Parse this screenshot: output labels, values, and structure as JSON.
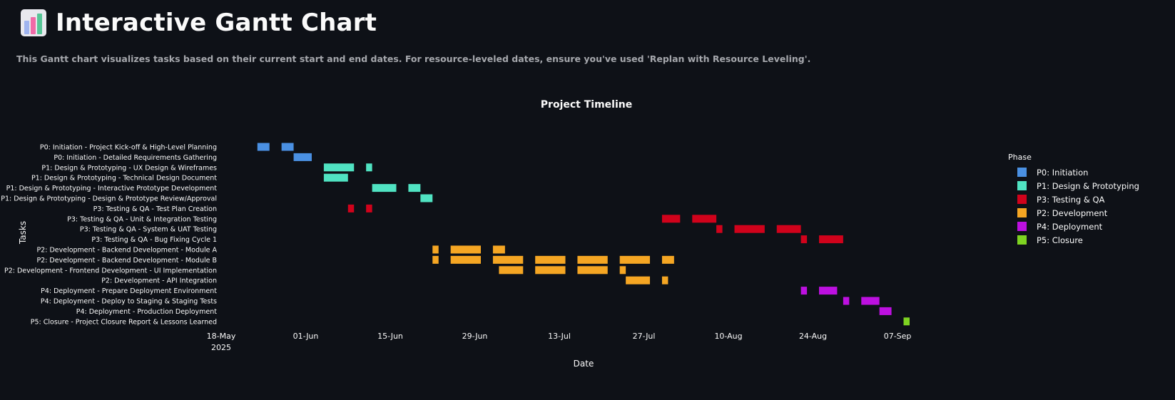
{
  "header": {
    "icon": "bar-chart-icon",
    "title": "Interactive Gantt Chart",
    "subtitle": "This Gantt chart visualizes tasks based on their current start and end dates. For resource-leveled dates, ensure you've used 'Replan with Resource Leveling'."
  },
  "legend": {
    "title": "Phase",
    "items": [
      {
        "label": "P0: Initiation",
        "color": "#4a90e2"
      },
      {
        "label": "P1: Design & Prototyping",
        "color": "#50e3c2"
      },
      {
        "label": "P3: Testing & QA",
        "color": "#d0021b"
      },
      {
        "label": "P2: Development",
        "color": "#f5a623"
      },
      {
        "label": "P4: Deployment",
        "color": "#bd10e0"
      },
      {
        "label": "P5: Closure",
        "color": "#7ed321"
      }
    ]
  },
  "chart_data": {
    "type": "bar",
    "subtype": "gantt",
    "title": "Project Timeline",
    "xlabel": "Date",
    "ylabel": "Tasks",
    "x_range": [
      "2025-05-18",
      "2025-09-09"
    ],
    "x_ticks": [
      {
        "date": "2025-05-18",
        "label": "18-May",
        "sublabel": "2025"
      },
      {
        "date": "2025-06-01",
        "label": "01-Jun"
      },
      {
        "date": "2025-06-15",
        "label": "15-Jun"
      },
      {
        "date": "2025-06-29",
        "label": "29-Jun"
      },
      {
        "date": "2025-07-13",
        "label": "13-Jul"
      },
      {
        "date": "2025-07-27",
        "label": "27-Jul"
      },
      {
        "date": "2025-08-10",
        "label": "10-Aug"
      },
      {
        "date": "2025-08-24",
        "label": "24-Aug"
      },
      {
        "date": "2025-09-07",
        "label": "07-Sep"
      }
    ],
    "legend_position": "right",
    "grid": false,
    "tasks": [
      {
        "name": "P0: Initiation - Project Kick-off & High-Level Planning",
        "phase": "P0: Initiation",
        "segments": [
          [
            "2025-05-24",
            "2025-05-26"
          ],
          [
            "2025-05-28",
            "2025-05-30"
          ]
        ]
      },
      {
        "name": "P0: Initiation - Detailed Requirements Gathering",
        "phase": "P0: Initiation",
        "segments": [
          [
            "2025-05-30",
            "2025-06-02"
          ]
        ]
      },
      {
        "name": "P1: Design & Prototyping - UX Design & Wireframes",
        "phase": "P1: Design & Prototyping",
        "segments": [
          [
            "2025-06-04",
            "2025-06-09"
          ],
          [
            "2025-06-11",
            "2025-06-12"
          ]
        ]
      },
      {
        "name": "P1: Design & Prototyping - Technical Design Document",
        "phase": "P1: Design & Prototyping",
        "segments": [
          [
            "2025-06-04",
            "2025-06-08"
          ]
        ]
      },
      {
        "name": "P1: Design & Prototyping - Interactive Prototype Development",
        "phase": "P1: Design & Prototyping",
        "segments": [
          [
            "2025-06-12",
            "2025-06-16"
          ],
          [
            "2025-06-18",
            "2025-06-20"
          ]
        ]
      },
      {
        "name": "P1: Design & Prototyping - Design & Prototype Review/Approval",
        "phase": "P1: Design & Prototyping",
        "segments": [
          [
            "2025-06-20",
            "2025-06-22"
          ]
        ]
      },
      {
        "name": "P3: Testing & QA - Test Plan Creation",
        "phase": "P3: Testing & QA",
        "segments": [
          [
            "2025-06-08",
            "2025-06-09"
          ],
          [
            "2025-06-11",
            "2025-06-12"
          ]
        ]
      },
      {
        "name": "P3: Testing & QA - Unit & Integration Testing",
        "phase": "P3: Testing & QA",
        "segments": [
          [
            "2025-07-30",
            "2025-08-02"
          ],
          [
            "2025-08-04",
            "2025-08-08"
          ]
        ]
      },
      {
        "name": "P3: Testing & QA - System & UAT Testing",
        "phase": "P3: Testing & QA",
        "segments": [
          [
            "2025-08-08",
            "2025-08-09"
          ],
          [
            "2025-08-11",
            "2025-08-16"
          ],
          [
            "2025-08-18",
            "2025-08-22"
          ]
        ]
      },
      {
        "name": "P3: Testing & QA - Bug Fixing Cycle 1",
        "phase": "P3: Testing & QA",
        "segments": [
          [
            "2025-08-22",
            "2025-08-23"
          ],
          [
            "2025-08-25",
            "2025-08-29"
          ]
        ]
      },
      {
        "name": "P2: Development - Backend Development - Module A",
        "phase": "P2: Development",
        "segments": [
          [
            "2025-06-22",
            "2025-06-23"
          ],
          [
            "2025-06-25",
            "2025-06-30"
          ],
          [
            "2025-07-02",
            "2025-07-04"
          ]
        ]
      },
      {
        "name": "P2: Development - Backend Development - Module B",
        "phase": "P2: Development",
        "segments": [
          [
            "2025-06-22",
            "2025-06-23"
          ],
          [
            "2025-06-25",
            "2025-06-30"
          ],
          [
            "2025-07-02",
            "2025-07-07"
          ],
          [
            "2025-07-09",
            "2025-07-14"
          ],
          [
            "2025-07-16",
            "2025-07-21"
          ],
          [
            "2025-07-23",
            "2025-07-28"
          ],
          [
            "2025-07-30",
            "2025-08-01"
          ]
        ]
      },
      {
        "name": "P2: Development - Frontend Development - UI Implementation",
        "phase": "P2: Development",
        "segments": [
          [
            "2025-07-03",
            "2025-07-07"
          ],
          [
            "2025-07-09",
            "2025-07-14"
          ],
          [
            "2025-07-16",
            "2025-07-21"
          ],
          [
            "2025-07-23",
            "2025-07-24"
          ]
        ]
      },
      {
        "name": "P2: Development - API Integration",
        "phase": "P2: Development",
        "segments": [
          [
            "2025-07-24",
            "2025-07-28"
          ],
          [
            "2025-07-30",
            "2025-07-31"
          ]
        ]
      },
      {
        "name": "P4: Deployment - Prepare Deployment Environment",
        "phase": "P4: Deployment",
        "segments": [
          [
            "2025-08-22",
            "2025-08-23"
          ],
          [
            "2025-08-25",
            "2025-08-28"
          ]
        ]
      },
      {
        "name": "P4: Deployment - Deploy to Staging & Staging Tests",
        "phase": "P4: Deployment",
        "segments": [
          [
            "2025-08-29",
            "2025-08-30"
          ],
          [
            "2025-09-01",
            "2025-09-04"
          ]
        ]
      },
      {
        "name": "P4: Deployment - Production Deployment",
        "phase": "P4: Deployment",
        "segments": [
          [
            "2025-09-04",
            "2025-09-06"
          ]
        ]
      },
      {
        "name": "P5: Closure - Project Closure Report & Lessons Learned",
        "phase": "P5: Closure",
        "segments": [
          [
            "2025-09-08",
            "2025-09-09"
          ]
        ]
      }
    ]
  }
}
